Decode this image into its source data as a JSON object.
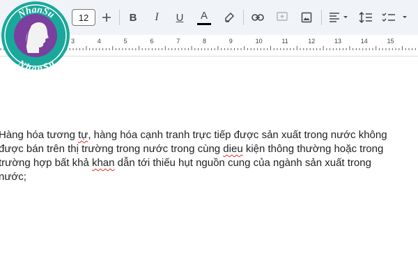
{
  "toolbar": {
    "font_size": "12",
    "icons": [
      "plus-icon",
      "bold-icon",
      "italic-icon",
      "underline-icon",
      "text-color-icon",
      "highlight-icon",
      "link-icon",
      "add-comment-icon",
      "insert-image-icon",
      "align-icon",
      "line-spacing-icon",
      "checklist-icon"
    ],
    "bold_label": "B",
    "italic_label": "I",
    "underline_label": "U",
    "text_color_label": "A",
    "text_color": "#000000"
  },
  "ruler": {
    "numbers": [
      "3",
      "4",
      "5",
      "6",
      "7",
      "8",
      "9",
      "10",
      "11",
      "12",
      "13",
      "14",
      "15"
    ]
  },
  "watermark": {
    "top_text": "NhanSu",
    "bottom_text": "NhanSu",
    "colors": {
      "outer": "#1aa89a",
      "inner": "#7b3fa0",
      "face": "#f2f2f2"
    }
  },
  "document": {
    "lines": [
      [
        "Hàng hóa tương ",
        {
          "t": "tự",
          "err": true
        },
        ", hàng hóa cạnh tranh trực tiếp được sản xuất trong nước không"
      ],
      [
        "được bán trên thị trường trong nước trong cùng ",
        {
          "t": "dieu",
          "err": true
        },
        " kiện thông thường hoặc trong"
      ],
      [
        "trường hợp bất khả ",
        {
          "t": "khan",
          "err": true
        },
        " dẫn tới thiếu hụt nguồn cung của ngành sản xuất trong"
      ],
      [
        "nước;"
      ]
    ]
  }
}
